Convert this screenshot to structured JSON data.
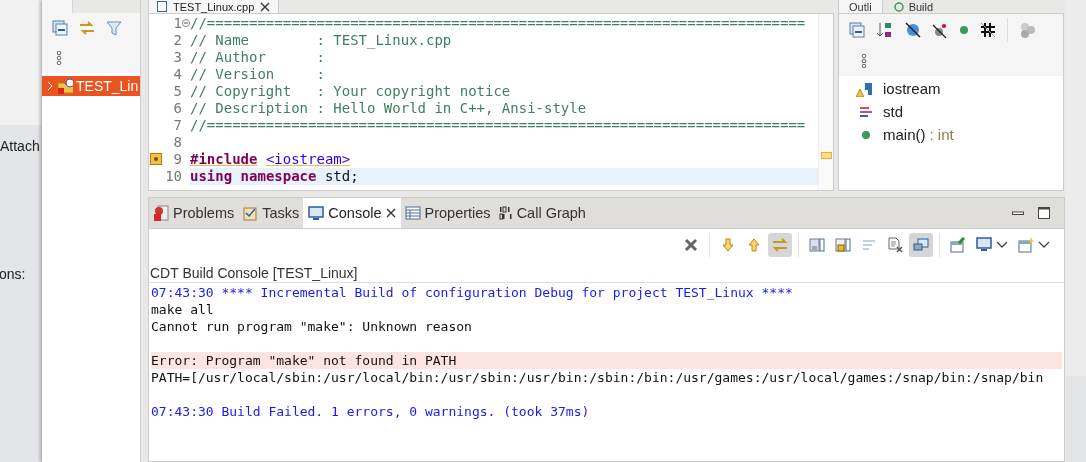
{
  "background": {
    "texts": [
      "Attach",
      "ons:"
    ]
  },
  "explorer": {
    "items": [
      {
        "label": "TEST_Lin",
        "selected": true,
        "expanded": false
      }
    ]
  },
  "editor": {
    "tab": {
      "title": "TEST_Linux.cpp"
    },
    "lines": [
      {
        "number": "1",
        "collapsible": true,
        "warning": false,
        "current": false,
        "tokens": [
          {
            "kind": "comment",
            "text": "//======================================================================="
          }
        ]
      },
      {
        "number": "2",
        "collapsible": false,
        "warning": false,
        "current": false,
        "tokens": [
          {
            "kind": "comment",
            "text": "// Name        : TEST_Linux.cpp"
          }
        ]
      },
      {
        "number": "3",
        "collapsible": false,
        "warning": false,
        "current": false,
        "tokens": [
          {
            "kind": "comment",
            "text": "// Author      :"
          }
        ]
      },
      {
        "number": "4",
        "collapsible": false,
        "warning": false,
        "current": false,
        "tokens": [
          {
            "kind": "comment",
            "text": "// Version     :"
          }
        ]
      },
      {
        "number": "5",
        "collapsible": false,
        "warning": false,
        "current": false,
        "tokens": [
          {
            "kind": "comment",
            "text": "// Copyright   : Your copyright notice"
          }
        ]
      },
      {
        "number": "6",
        "collapsible": false,
        "warning": false,
        "current": false,
        "tokens": [
          {
            "kind": "comment",
            "text": "// Description : Hello World in C++, Ansi-style"
          }
        ]
      },
      {
        "number": "7",
        "collapsible": false,
        "warning": false,
        "current": false,
        "tokens": [
          {
            "kind": "comment",
            "text": "//======================================================================="
          }
        ]
      },
      {
        "number": "8",
        "collapsible": false,
        "warning": false,
        "current": false
      },
      {
        "number": "9",
        "collapsible": false,
        "warning": true,
        "current": false,
        "tokens": [
          {
            "kind": "directive",
            "text": "#include"
          },
          {
            "kind": "header",
            "text": "<iostream>"
          }
        ]
      },
      {
        "number": "10",
        "collapsible": false,
        "warning": false,
        "current": true,
        "tokens": [
          {
            "kind": "keyword",
            "text": "using"
          },
          {
            "kind": "keyword",
            "text": "namespace"
          },
          {
            "kind": "plain",
            "text": "std;"
          }
        ]
      }
    ]
  },
  "outline": {
    "tabs": [
      {
        "label": "Outli",
        "selected": true
      },
      {
        "label": "Build",
        "selected": false
      }
    ],
    "items": [
      {
        "kind": "include",
        "name": "iostream",
        "warning": true
      },
      {
        "kind": "namespace",
        "name": "std",
        "warning": false
      },
      {
        "kind": "function",
        "name": "main()",
        "type": ": int",
        "warning": false
      }
    ]
  },
  "console_panel": {
    "tabs": [
      {
        "kind": "problems",
        "label": "Problems",
        "selected": false
      },
      {
        "kind": "tasks",
        "label": "Tasks",
        "selected": false
      },
      {
        "kind": "console",
        "label": "Console",
        "selected": true
      },
      {
        "kind": "properties",
        "label": "Properties",
        "selected": false
      },
      {
        "kind": "callgraph",
        "label": "Call Graph",
        "selected": false
      }
    ],
    "toolbar": [
      [
        {
          "kind": "remove",
          "pressed": false,
          "menu": false
        }
      ],
      [
        {
          "kind": "next",
          "pressed": false,
          "menu": false
        },
        {
          "kind": "previous",
          "pressed": false,
          "menu": false
        },
        {
          "kind": "link",
          "pressed": true,
          "menu": false
        }
      ],
      [
        {
          "kind": "save",
          "pressed": false,
          "menu": false
        },
        {
          "kind": "lock",
          "pressed": false,
          "menu": false
        },
        {
          "kind": "wrap",
          "pressed": false,
          "menu": false
        },
        {
          "kind": "clear",
          "pressed": false,
          "menu": false
        },
        {
          "kind": "show",
          "pressed": true,
          "menu": false
        }
      ],
      [
        {
          "kind": "pin",
          "pressed": false,
          "menu": false
        },
        {
          "kind": "display",
          "pressed": false,
          "menu": true
        },
        {
          "kind": "new",
          "pressed": false,
          "menu": true
        }
      ]
    ],
    "title": "CDT Build Console [TEST_Linux]",
    "lines": [
      {
        "kind": "info",
        "text": "07:43:30 **** Incremental Build of configuration Debug for project TEST_Linux ****"
      },
      {
        "kind": "plain",
        "text": "make all"
      },
      {
        "kind": "plain",
        "text": "Cannot run program \"make\": Unknown reason"
      },
      {
        "kind": "blank"
      },
      {
        "kind": "error",
        "text": "Error: Program \"make\" not found in PATH"
      },
      {
        "kind": "plain",
        "text": "PATH=[/usr/local/sbin:/usr/local/bin:/usr/sbin:/usr/bin:/sbin:/bin:/usr/games:/usr/local/games:/snap/bin:/snap/bin"
      },
      {
        "kind": "blank"
      },
      {
        "kind": "info",
        "text": "07:43:30 Build Failed. 1 errors, 0 warnings. (took 37ms)"
      }
    ]
  }
}
